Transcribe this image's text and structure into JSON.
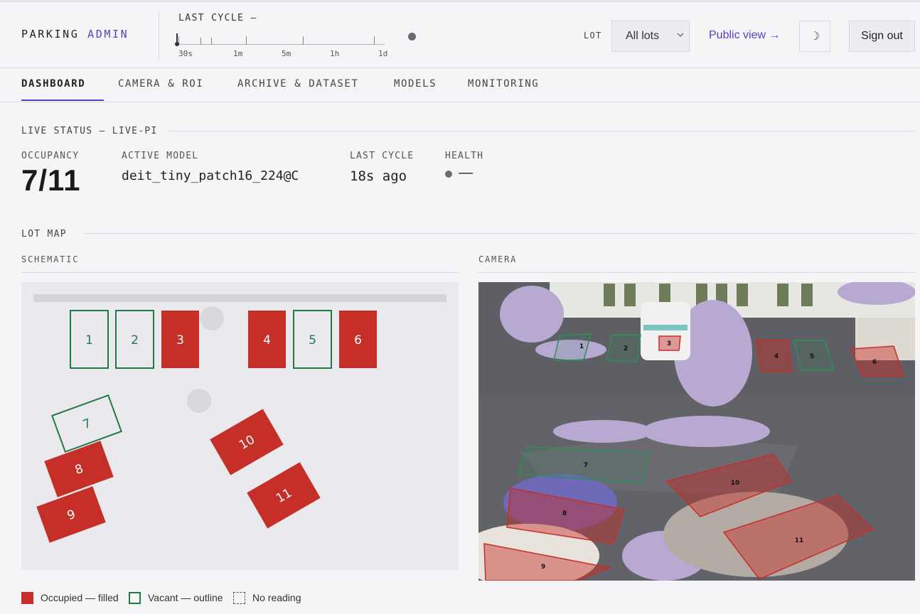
{
  "header": {
    "brand_part1": "PARKING",
    "brand_part2": "ADMIN",
    "last_cycle_title": "LAST CYCLE —",
    "slider_ticks": [
      "30s",
      "1m",
      "5m",
      "1h",
      "1d"
    ],
    "lot_label": "LOT",
    "lot_select_value": "All lots",
    "public_view_label": "Public view →",
    "theme_icon": "☽",
    "sign_out_label": "Sign out"
  },
  "tabs": [
    {
      "label": "DASHBOARD",
      "active": true
    },
    {
      "label": "CAMERA & ROI",
      "active": false
    },
    {
      "label": "ARCHIVE & DATASET",
      "active": false
    },
    {
      "label": "MODELS",
      "active": false
    },
    {
      "label": "MONITORING",
      "active": false
    }
  ],
  "live_status": {
    "heading": "LIVE STATUS — LIVE-PI",
    "occupancy_label": "OCCUPANCY",
    "occupancy_value": "7/11",
    "active_model_label": "ACTIVE MODEL",
    "active_model_value": "deit_tiny_patch16_224@C",
    "last_cycle_label": "LAST CYCLE",
    "last_cycle_value": "18s ago",
    "health_label": "HEALTH",
    "health_value": "—"
  },
  "lot_map": {
    "heading": "LOT MAP",
    "schematic_label": "SCHEMATIC",
    "camera_label": "CAMERA",
    "spots": [
      {
        "id": "1",
        "status": "vacant"
      },
      {
        "id": "2",
        "status": "vacant"
      },
      {
        "id": "3",
        "status": "occupied"
      },
      {
        "id": "4",
        "status": "occupied"
      },
      {
        "id": "5",
        "status": "vacant"
      },
      {
        "id": "6",
        "status": "occupied"
      },
      {
        "id": "7",
        "status": "vacant"
      },
      {
        "id": "8",
        "status": "occupied"
      },
      {
        "id": "9",
        "status": "occupied"
      },
      {
        "id": "10",
        "status": "occupied"
      },
      {
        "id": "11",
        "status": "occupied"
      }
    ]
  },
  "legend": {
    "occupied": "Occupied — filled",
    "vacant": "Vacant — outline",
    "no_reading": "No reading"
  },
  "colors": {
    "accent": "#5a3fc0",
    "occupied": "#c62f28",
    "vacant": "#1f7a43"
  }
}
